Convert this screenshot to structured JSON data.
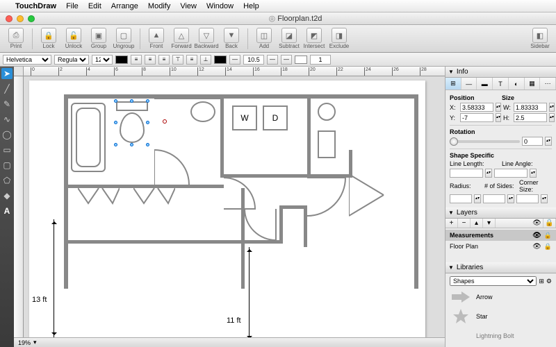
{
  "menubar": {
    "app": "TouchDraw",
    "items": [
      "File",
      "Edit",
      "Arrange",
      "Modify",
      "View",
      "Window",
      "Help"
    ]
  },
  "document": {
    "title": "Floorplan.t2d"
  },
  "toolbar": {
    "print": "Print",
    "lock": "Lock",
    "unlock": "Unlock",
    "group": "Group",
    "ungroup": "Ungroup",
    "front": "Front",
    "forward": "Forward",
    "backward": "Backward",
    "back": "Back",
    "add": "Add",
    "subtract": "Subtract",
    "intersect": "Intersect",
    "exclude": "Exclude",
    "sidebar": "Sidebar"
  },
  "format": {
    "font": "Helvetica",
    "style": "Regular",
    "size": "12",
    "stroke_w": "10.5",
    "stroke_w2": "1"
  },
  "ruler": {
    "marks": [
      "0",
      "2",
      "4",
      "6",
      "8",
      "10",
      "12",
      "14",
      "16",
      "18",
      "20",
      "22",
      "24",
      "26",
      "28"
    ]
  },
  "canvas": {
    "zoom": "19%",
    "dim1": "13 ft",
    "dim2": "11 ft",
    "washer": "W",
    "dryer": "D"
  },
  "info": {
    "title": "Info",
    "pos_label": "Position",
    "size_label": "Size",
    "x": "3.58333",
    "w": "1.83333",
    "y": "-7",
    "h": "2.5",
    "rotation_label": "Rotation",
    "rotation": "0",
    "shape_specific": "Shape Specific",
    "line_length": "Line Length:",
    "line_angle": "Line Angle:",
    "radius": "Radius:",
    "sides": "# of Sides:",
    "corner": "Corner Size:"
  },
  "layers": {
    "title": "Layers",
    "items": [
      {
        "name": "Measurements",
        "selected": true
      },
      {
        "name": "Floor Plan",
        "selected": false
      }
    ]
  },
  "libraries": {
    "title": "Libraries",
    "set": "Shapes",
    "items": [
      "Arrow",
      "Star",
      "Lightning Bolt"
    ]
  }
}
